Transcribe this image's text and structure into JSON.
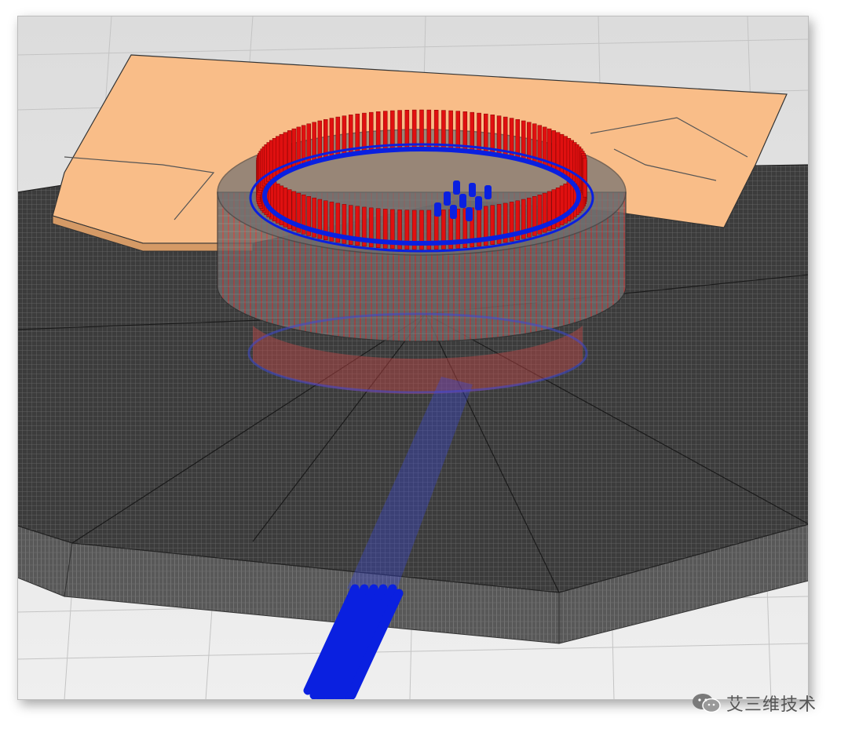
{
  "scene": {
    "description_label": "",
    "colors": {
      "background": "#e8e8e8",
      "slab": "#f9bd88",
      "platform": "#404040",
      "rebar_red": "#e01010",
      "rebar_blue": "#0a20e0",
      "cylinder": "#5a5a5a"
    },
    "red_bar_count": 140,
    "outer_blue_pile_count": 14,
    "small_blue_column_count": 9
  },
  "watermark": {
    "icon": "wechat-icon",
    "text": "艾三维技术"
  }
}
